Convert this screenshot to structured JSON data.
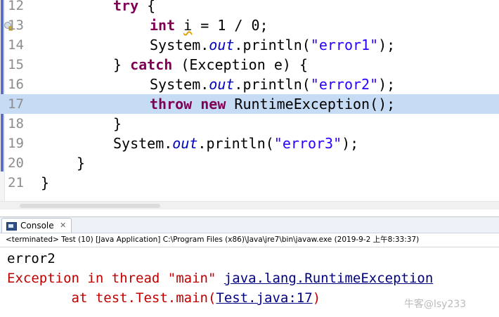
{
  "editor": {
    "lines": [
      {
        "num": "12"
      },
      {
        "num": "13"
      },
      {
        "num": "14"
      },
      {
        "num": "15"
      },
      {
        "num": "16"
      },
      {
        "num": "17"
      },
      {
        "num": "18"
      },
      {
        "num": "19"
      },
      {
        "num": "20"
      },
      {
        "num": "21"
      }
    ],
    "tok": {
      "try": "try",
      "open_brace": " {",
      "int": "int",
      "var_i": "i",
      "assign": " = 1 / 0;",
      "sys1": "System.",
      "out1": "out",
      "println1": ".println(",
      "s1": "\"error1\"",
      "end1": ");",
      "close_catch": "} ",
      "catch": "catch",
      "catch_args": " (Exception ",
      "var_e": "e",
      "catch_open": ") {",
      "sys2": "System.",
      "out2": "out",
      "println2": ".println(",
      "s2": "\"error2\"",
      "end2": ");",
      "throw": "throw",
      "new": "new",
      "rt": " RuntimeException();",
      "close1": "}",
      "sys3": "System.",
      "out3": "out",
      "println3": ".println(",
      "s3": "\"error3\"",
      "end3": ");",
      "close2": "}",
      "close3": "}"
    },
    "highlighted_line": "17"
  },
  "console": {
    "tab_title": "Console",
    "tab_close": "✕",
    "status": "<terminated> Test (10) [Java Application] C:\\Program Files (x86)\\Java\\jre7\\bin\\javaw.exe (2019-9-2 上午8:33:37)",
    "output": {
      "line1": "error2",
      "exc_prefix": "Exception in thread \"main\" ",
      "exc_link": "java.lang.RuntimeException",
      "at_prefix": "        at test.Test.main(",
      "at_link": "Test.java:17",
      "at_suffix": ")"
    }
  },
  "watermark": "牛客@lsy233",
  "colors": {
    "keyword": "#7f0055",
    "string": "#2a00ff",
    "field": "#0000c0",
    "error": "#c00000",
    "highlight": "#c6dbf4"
  }
}
